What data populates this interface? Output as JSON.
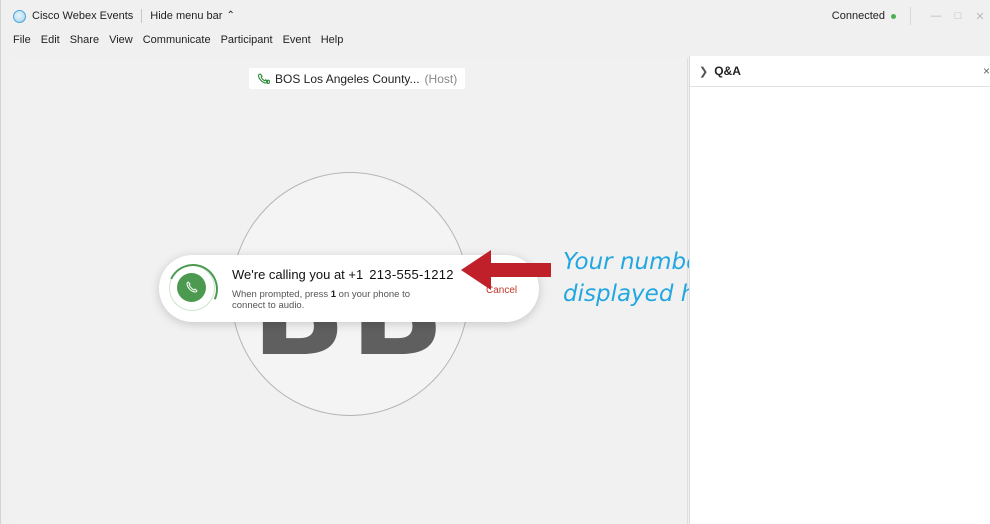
{
  "titlebar": {
    "app_title": "Cisco Webex Events",
    "hide_menu_label": "Hide menu bar",
    "status": "Connected"
  },
  "menu": {
    "items": [
      "File",
      "Edit",
      "Share",
      "View",
      "Communicate",
      "Participant",
      "Event",
      "Help"
    ]
  },
  "stage": {
    "host_name": "BOS Los Angeles County...",
    "host_role": "(Host)",
    "avatar_initials": "BB"
  },
  "call": {
    "title_prefix": "We're calling you at +1",
    "phone_number": "213-555-1212",
    "subtext_before": "When prompted, press ",
    "subtext_key": "1",
    "subtext_after": " on your phone to connect to audio.",
    "cancel_label": "Cancel"
  },
  "annotation": {
    "line1": "Your number will be",
    "line2": "displayed here",
    "arrow_color": "#c0202a",
    "text_color": "#22a7e0"
  },
  "qa_panel": {
    "title": "Q&A",
    "close_label": "×"
  },
  "colors": {
    "call_green": "#4b9a4f",
    "status_green": "#4caf50",
    "cancel_red": "#c0392b"
  }
}
